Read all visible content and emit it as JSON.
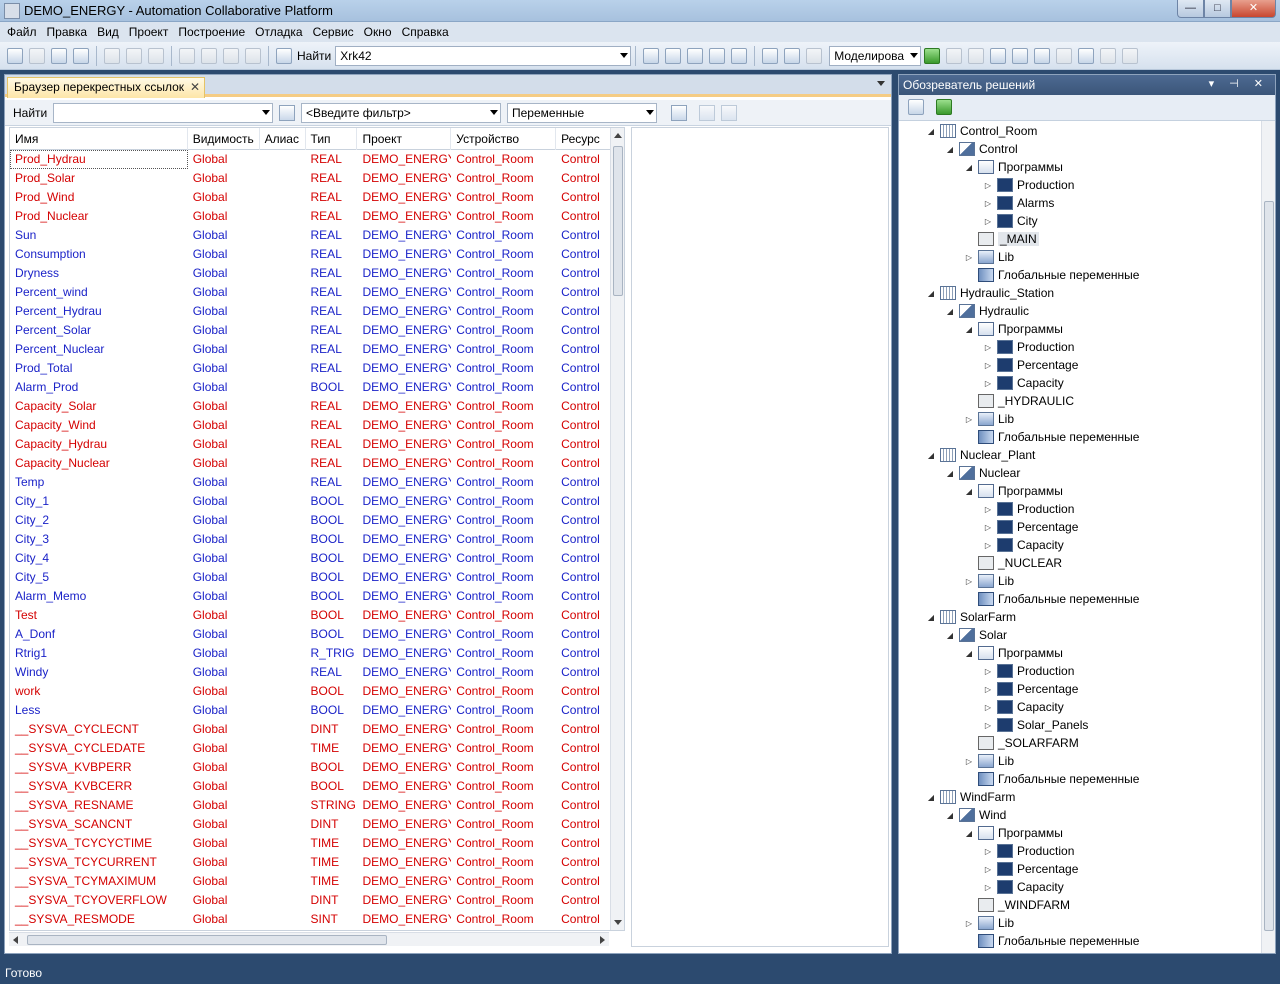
{
  "window": {
    "title": "DEMO_ENERGY - Automation Collaborative Platform",
    "buttons": {
      "minimize": "—",
      "maximize": "□",
      "close": "✕"
    }
  },
  "menu": [
    "Файл",
    "Правка",
    "Вид",
    "Проект",
    "Построение",
    "Отладка",
    "Сервис",
    "Окно",
    "Справка"
  ],
  "toolbar": {
    "find_label": "Найти",
    "find_value": "Xrk42",
    "mode_value": "Моделирова"
  },
  "left_tab": {
    "label": "Браузер перекрестных ссылок",
    "close": "✕",
    "filter_find_label": "Найти",
    "filter_find_value": "",
    "filter_placeholder": "<Введите фильтр>",
    "category_value": "Переменные"
  },
  "grid": {
    "columns": [
      "Имя",
      "Видимость",
      "Алиас",
      "Тип",
      "Проект",
      "Устройство",
      "Ресурс"
    ],
    "rows": [
      {
        "name": "Prod_Hydrau",
        "vis": "Global",
        "alias": "",
        "type": "REAL",
        "proj": "DEMO_ENERGY",
        "dev": "Control_Room",
        "res": "Control",
        "color": "red"
      },
      {
        "name": "Prod_Solar",
        "vis": "Global",
        "alias": "",
        "type": "REAL",
        "proj": "DEMO_ENERGY",
        "dev": "Control_Room",
        "res": "Control",
        "color": "red"
      },
      {
        "name": "Prod_Wind",
        "vis": "Global",
        "alias": "",
        "type": "REAL",
        "proj": "DEMO_ENERGY",
        "dev": "Control_Room",
        "res": "Control",
        "color": "red"
      },
      {
        "name": "Prod_Nuclear",
        "vis": "Global",
        "alias": "",
        "type": "REAL",
        "proj": "DEMO_ENERGY",
        "dev": "Control_Room",
        "res": "Control",
        "color": "red"
      },
      {
        "name": "Sun",
        "vis": "Global",
        "alias": "",
        "type": "REAL",
        "proj": "DEMO_ENERGY",
        "dev": "Control_Room",
        "res": "Control",
        "color": "blue"
      },
      {
        "name": "Consumption",
        "vis": "Global",
        "alias": "",
        "type": "REAL",
        "proj": "DEMO_ENERGY",
        "dev": "Control_Room",
        "res": "Control",
        "color": "blue"
      },
      {
        "name": "Dryness",
        "vis": "Global",
        "alias": "",
        "type": "REAL",
        "proj": "DEMO_ENERGY",
        "dev": "Control_Room",
        "res": "Control",
        "color": "blue"
      },
      {
        "name": "Percent_wind",
        "vis": "Global",
        "alias": "",
        "type": "REAL",
        "proj": "DEMO_ENERGY",
        "dev": "Control_Room",
        "res": "Control",
        "color": "blue"
      },
      {
        "name": "Percent_Hydrau",
        "vis": "Global",
        "alias": "",
        "type": "REAL",
        "proj": "DEMO_ENERGY",
        "dev": "Control_Room",
        "res": "Control",
        "color": "blue"
      },
      {
        "name": "Percent_Solar",
        "vis": "Global",
        "alias": "",
        "type": "REAL",
        "proj": "DEMO_ENERGY",
        "dev": "Control_Room",
        "res": "Control",
        "color": "blue"
      },
      {
        "name": "Percent_Nuclear",
        "vis": "Global",
        "alias": "",
        "type": "REAL",
        "proj": "DEMO_ENERGY",
        "dev": "Control_Room",
        "res": "Control",
        "color": "blue"
      },
      {
        "name": "Prod_Total",
        "vis": "Global",
        "alias": "",
        "type": "REAL",
        "proj": "DEMO_ENERGY",
        "dev": "Control_Room",
        "res": "Control",
        "color": "blue"
      },
      {
        "name": "Alarm_Prod",
        "vis": "Global",
        "alias": "",
        "type": "BOOL",
        "proj": "DEMO_ENERGY",
        "dev": "Control_Room",
        "res": "Control",
        "color": "blue"
      },
      {
        "name": "Capacity_Solar",
        "vis": "Global",
        "alias": "",
        "type": "REAL",
        "proj": "DEMO_ENERGY",
        "dev": "Control_Room",
        "res": "Control",
        "color": "red"
      },
      {
        "name": "Capacity_Wind",
        "vis": "Global",
        "alias": "",
        "type": "REAL",
        "proj": "DEMO_ENERGY",
        "dev": "Control_Room",
        "res": "Control",
        "color": "red"
      },
      {
        "name": "Capacity_Hydrau",
        "vis": "Global",
        "alias": "",
        "type": "REAL",
        "proj": "DEMO_ENERGY",
        "dev": "Control_Room",
        "res": "Control",
        "color": "red"
      },
      {
        "name": "Capacity_Nuclear",
        "vis": "Global",
        "alias": "",
        "type": "REAL",
        "proj": "DEMO_ENERGY",
        "dev": "Control_Room",
        "res": "Control",
        "color": "red"
      },
      {
        "name": "Temp",
        "vis": "Global",
        "alias": "",
        "type": "REAL",
        "proj": "DEMO_ENERGY",
        "dev": "Control_Room",
        "res": "Control",
        "color": "blue"
      },
      {
        "name": "City_1",
        "vis": "Global",
        "alias": "",
        "type": "BOOL",
        "proj": "DEMO_ENERGY",
        "dev": "Control_Room",
        "res": "Control",
        "color": "blue"
      },
      {
        "name": "City_2",
        "vis": "Global",
        "alias": "",
        "type": "BOOL",
        "proj": "DEMO_ENERGY",
        "dev": "Control_Room",
        "res": "Control",
        "color": "blue"
      },
      {
        "name": "City_3",
        "vis": "Global",
        "alias": "",
        "type": "BOOL",
        "proj": "DEMO_ENERGY",
        "dev": "Control_Room",
        "res": "Control",
        "color": "blue"
      },
      {
        "name": "City_4",
        "vis": "Global",
        "alias": "",
        "type": "BOOL",
        "proj": "DEMO_ENERGY",
        "dev": "Control_Room",
        "res": "Control",
        "color": "blue"
      },
      {
        "name": "City_5",
        "vis": "Global",
        "alias": "",
        "type": "BOOL",
        "proj": "DEMO_ENERGY",
        "dev": "Control_Room",
        "res": "Control",
        "color": "blue"
      },
      {
        "name": "Alarm_Memo",
        "vis": "Global",
        "alias": "",
        "type": "BOOL",
        "proj": "DEMO_ENERGY",
        "dev": "Control_Room",
        "res": "Control",
        "color": "blue"
      },
      {
        "name": "Test",
        "vis": "Global",
        "alias": "",
        "type": "BOOL",
        "proj": "DEMO_ENERGY",
        "dev": "Control_Room",
        "res": "Control",
        "color": "red"
      },
      {
        "name": "A_Donf",
        "vis": "Global",
        "alias": "",
        "type": "BOOL",
        "proj": "DEMO_ENERGY",
        "dev": "Control_Room",
        "res": "Control",
        "color": "blue"
      },
      {
        "name": "Rtrig1",
        "vis": "Global",
        "alias": "",
        "type": "R_TRIG",
        "proj": "DEMO_ENERGY",
        "dev": "Control_Room",
        "res": "Control",
        "color": "blue"
      },
      {
        "name": "Windy",
        "vis": "Global",
        "alias": "",
        "type": "REAL",
        "proj": "DEMO_ENERGY",
        "dev": "Control_Room",
        "res": "Control",
        "color": "blue"
      },
      {
        "name": "work",
        "vis": "Global",
        "alias": "",
        "type": "BOOL",
        "proj": "DEMO_ENERGY",
        "dev": "Control_Room",
        "res": "Control",
        "color": "red"
      },
      {
        "name": "Less",
        "vis": "Global",
        "alias": "",
        "type": "BOOL",
        "proj": "DEMO_ENERGY",
        "dev": "Control_Room",
        "res": "Control",
        "color": "blue"
      },
      {
        "name": "__SYSVA_CYCLECNT",
        "vis": "Global",
        "alias": "",
        "type": "DINT",
        "proj": "DEMO_ENERGY",
        "dev": "Control_Room",
        "res": "Control",
        "color": "red"
      },
      {
        "name": "__SYSVA_CYCLEDATE",
        "vis": "Global",
        "alias": "",
        "type": "TIME",
        "proj": "DEMO_ENERGY",
        "dev": "Control_Room",
        "res": "Control",
        "color": "red"
      },
      {
        "name": "__SYSVA_KVBPERR",
        "vis": "Global",
        "alias": "",
        "type": "BOOL",
        "proj": "DEMO_ENERGY",
        "dev": "Control_Room",
        "res": "Control",
        "color": "red"
      },
      {
        "name": "__SYSVA_KVBCERR",
        "vis": "Global",
        "alias": "",
        "type": "BOOL",
        "proj": "DEMO_ENERGY",
        "dev": "Control_Room",
        "res": "Control",
        "color": "red"
      },
      {
        "name": "__SYSVA_RESNAME",
        "vis": "Global",
        "alias": "",
        "type": "STRING",
        "proj": "DEMO_ENERGY",
        "dev": "Control_Room",
        "res": "Control",
        "color": "red"
      },
      {
        "name": "__SYSVA_SCANCNT",
        "vis": "Global",
        "alias": "",
        "type": "DINT",
        "proj": "DEMO_ENERGY",
        "dev": "Control_Room",
        "res": "Control",
        "color": "red"
      },
      {
        "name": "__SYSVA_TCYCYCTIME",
        "vis": "Global",
        "alias": "",
        "type": "TIME",
        "proj": "DEMO_ENERGY",
        "dev": "Control_Room",
        "res": "Control",
        "color": "red"
      },
      {
        "name": "__SYSVA_TCYCURRENT",
        "vis": "Global",
        "alias": "",
        "type": "TIME",
        "proj": "DEMO_ENERGY",
        "dev": "Control_Room",
        "res": "Control",
        "color": "red"
      },
      {
        "name": "__SYSVA_TCYMAXIMUM",
        "vis": "Global",
        "alias": "",
        "type": "TIME",
        "proj": "DEMO_ENERGY",
        "dev": "Control_Room",
        "res": "Control",
        "color": "red"
      },
      {
        "name": "__SYSVA_TCYOVERFLOW",
        "vis": "Global",
        "alias": "",
        "type": "DINT",
        "proj": "DEMO_ENERGY",
        "dev": "Control_Room",
        "res": "Control",
        "color": "red"
      },
      {
        "name": "__SYSVA_RESMODE",
        "vis": "Global",
        "alias": "",
        "type": "SINT",
        "proj": "DEMO_ENERGY",
        "dev": "Control_Room",
        "res": "Control",
        "color": "red"
      }
    ]
  },
  "solution_explorer": {
    "title": "Обозреватель решений",
    "controls": "▾ ⊣ ✕",
    "tree": [
      {
        "level": 0,
        "exp": "◢",
        "icon": "device",
        "label": "Control_Room"
      },
      {
        "level": 1,
        "exp": "◢",
        "icon": "resource",
        "label": "Control"
      },
      {
        "level": 2,
        "exp": "◢",
        "icon": "folder",
        "label": "Программы"
      },
      {
        "level": 3,
        "exp": "▷",
        "icon": "program",
        "label": "Production"
      },
      {
        "level": 3,
        "exp": "▷",
        "icon": "program",
        "label": "Alarms"
      },
      {
        "level": 3,
        "exp": "▷",
        "icon": "program",
        "label": "City"
      },
      {
        "level": 2,
        "exp": "",
        "icon": "task",
        "label": "_MAIN",
        "selected": true
      },
      {
        "level": 2,
        "exp": "▷",
        "icon": "lib",
        "label": "Lib"
      },
      {
        "level": 2,
        "exp": "",
        "icon": "globals",
        "label": "Глобальные переменные"
      },
      {
        "level": 0,
        "exp": "◢",
        "icon": "device",
        "label": "Hydraulic_Station"
      },
      {
        "level": 1,
        "exp": "◢",
        "icon": "resource",
        "label": "Hydraulic"
      },
      {
        "level": 2,
        "exp": "◢",
        "icon": "folder",
        "label": "Программы"
      },
      {
        "level": 3,
        "exp": "▷",
        "icon": "program",
        "label": "Production"
      },
      {
        "level": 3,
        "exp": "▷",
        "icon": "program",
        "label": "Percentage"
      },
      {
        "level": 3,
        "exp": "▷",
        "icon": "program",
        "label": "Capacity"
      },
      {
        "level": 2,
        "exp": "",
        "icon": "task",
        "label": "_HYDRAULIC"
      },
      {
        "level": 2,
        "exp": "▷",
        "icon": "lib",
        "label": "Lib"
      },
      {
        "level": 2,
        "exp": "",
        "icon": "globals",
        "label": "Глобальные переменные"
      },
      {
        "level": 0,
        "exp": "◢",
        "icon": "device",
        "label": "Nuclear_Plant"
      },
      {
        "level": 1,
        "exp": "◢",
        "icon": "resource",
        "label": "Nuclear"
      },
      {
        "level": 2,
        "exp": "◢",
        "icon": "folder",
        "label": "Программы"
      },
      {
        "level": 3,
        "exp": "▷",
        "icon": "program",
        "label": "Production"
      },
      {
        "level": 3,
        "exp": "▷",
        "icon": "program",
        "label": "Percentage"
      },
      {
        "level": 3,
        "exp": "▷",
        "icon": "program",
        "label": "Capacity"
      },
      {
        "level": 2,
        "exp": "",
        "icon": "task",
        "label": "_NUCLEAR"
      },
      {
        "level": 2,
        "exp": "▷",
        "icon": "lib",
        "label": "Lib"
      },
      {
        "level": 2,
        "exp": "",
        "icon": "globals",
        "label": "Глобальные переменные"
      },
      {
        "level": 0,
        "exp": "◢",
        "icon": "device",
        "label": "SolarFarm"
      },
      {
        "level": 1,
        "exp": "◢",
        "icon": "resource",
        "label": "Solar"
      },
      {
        "level": 2,
        "exp": "◢",
        "icon": "folder",
        "label": "Программы"
      },
      {
        "level": 3,
        "exp": "▷",
        "icon": "program",
        "label": "Production"
      },
      {
        "level": 3,
        "exp": "▷",
        "icon": "program",
        "label": "Percentage"
      },
      {
        "level": 3,
        "exp": "▷",
        "icon": "program",
        "label": "Capacity"
      },
      {
        "level": 3,
        "exp": "▷",
        "icon": "program",
        "label": "Solar_Panels"
      },
      {
        "level": 2,
        "exp": "",
        "icon": "task",
        "label": "_SOLARFARM"
      },
      {
        "level": 2,
        "exp": "▷",
        "icon": "lib",
        "label": "Lib"
      },
      {
        "level": 2,
        "exp": "",
        "icon": "globals",
        "label": "Глобальные переменные"
      },
      {
        "level": 0,
        "exp": "◢",
        "icon": "device",
        "label": "WindFarm"
      },
      {
        "level": 1,
        "exp": "◢",
        "icon": "resource",
        "label": "Wind"
      },
      {
        "level": 2,
        "exp": "◢",
        "icon": "folder",
        "label": "Программы"
      },
      {
        "level": 3,
        "exp": "▷",
        "icon": "program",
        "label": "Production"
      },
      {
        "level": 3,
        "exp": "▷",
        "icon": "program",
        "label": "Percentage"
      },
      {
        "level": 3,
        "exp": "▷",
        "icon": "program",
        "label": "Capacity"
      },
      {
        "level": 2,
        "exp": "",
        "icon": "task",
        "label": "_WINDFARM"
      },
      {
        "level": 2,
        "exp": "▷",
        "icon": "lib",
        "label": "Lib"
      },
      {
        "level": 2,
        "exp": "",
        "icon": "globals",
        "label": "Глобальные переменные"
      }
    ]
  },
  "status": {
    "text": "Готово"
  }
}
